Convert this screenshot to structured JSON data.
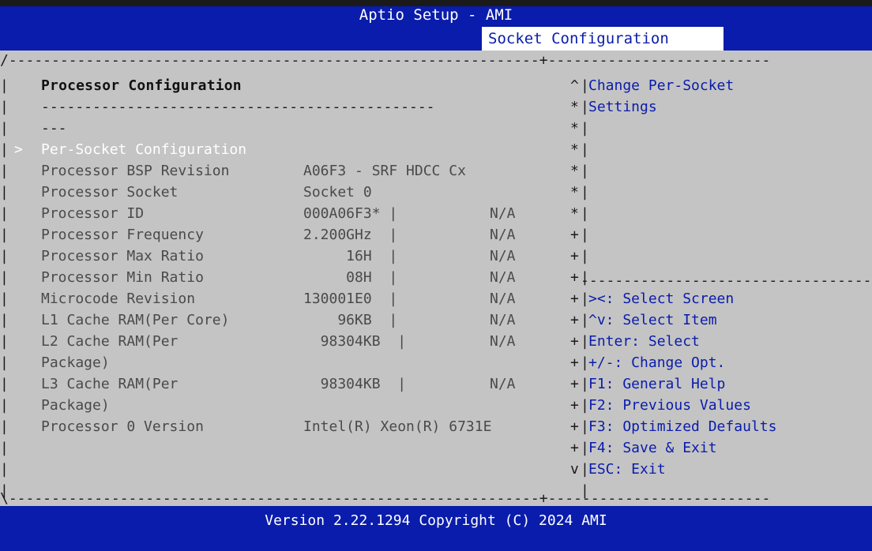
{
  "header": {
    "title": "Aptio Setup - AMI",
    "tab": "Socket Configuration"
  },
  "main": {
    "heading": "Processor Configuration",
    "separator": "----------------------------------------------",
    "separator2": "---",
    "selected_item": "Per-Socket Configuration",
    "rows": [
      {
        "label": "Processor BSP Revision",
        "value": "A06F3 - SRF HDCC Cx"
      },
      {
        "label": "Processor Socket",
        "value": "Socket 0"
      },
      {
        "label": "Processor ID",
        "value": "000A06F3* |",
        "extra": "N/A"
      },
      {
        "label": "Processor Frequency",
        "value": "2.200GHz  |",
        "extra": "N/A"
      },
      {
        "label": "Processor Max Ratio",
        "value": "     16H  |",
        "extra": "N/A"
      },
      {
        "label": "Processor Min Ratio",
        "value": "     08H  |",
        "extra": "N/A"
      },
      {
        "label": "Microcode Revision",
        "value": "130001E0  |",
        "extra": "N/A"
      },
      {
        "label": "L1 Cache RAM(Per Core)",
        "value": "    96KB  |",
        "extra": "N/A"
      },
      {
        "label": "L2 Cache RAM(Per",
        "value": "  98304KB  |",
        "extra": "N/A"
      },
      {
        "label": "Package)",
        "value": ""
      },
      {
        "label": "L3 Cache RAM(Per",
        "value": "  98304KB  |",
        "extra": "N/A"
      },
      {
        "label": "Package)",
        "value": ""
      },
      {
        "label": "Processor 0 Version",
        "value": "Intel(R) Xeon(R) 6731E"
      }
    ]
  },
  "help": {
    "description": [
      "Change Per-Socket",
      "Settings"
    ],
    "keys": [
      "><: Select Screen",
      "^v: Select Item",
      "Enter: Select",
      "+/-: Change Opt.",
      "F1: General Help",
      "F2: Previous Values",
      "F3: Optimized Defaults",
      "F4: Save & Exit",
      "ESC: Exit"
    ],
    "scroll_marks": [
      "^",
      "*",
      "*",
      "*",
      "*",
      "*",
      "*",
      "+",
      "+",
      "+",
      "+",
      "+",
      "+",
      "+",
      "+",
      "+",
      "+",
      "+",
      "v"
    ]
  },
  "footer": {
    "text": "Version 2.22.1294 Copyright (C) 2024 AMI"
  },
  "colors": {
    "bar_blue": "#0a1cab",
    "panel_gray": "#c4c4c4",
    "selected_white": "#ffffff"
  }
}
